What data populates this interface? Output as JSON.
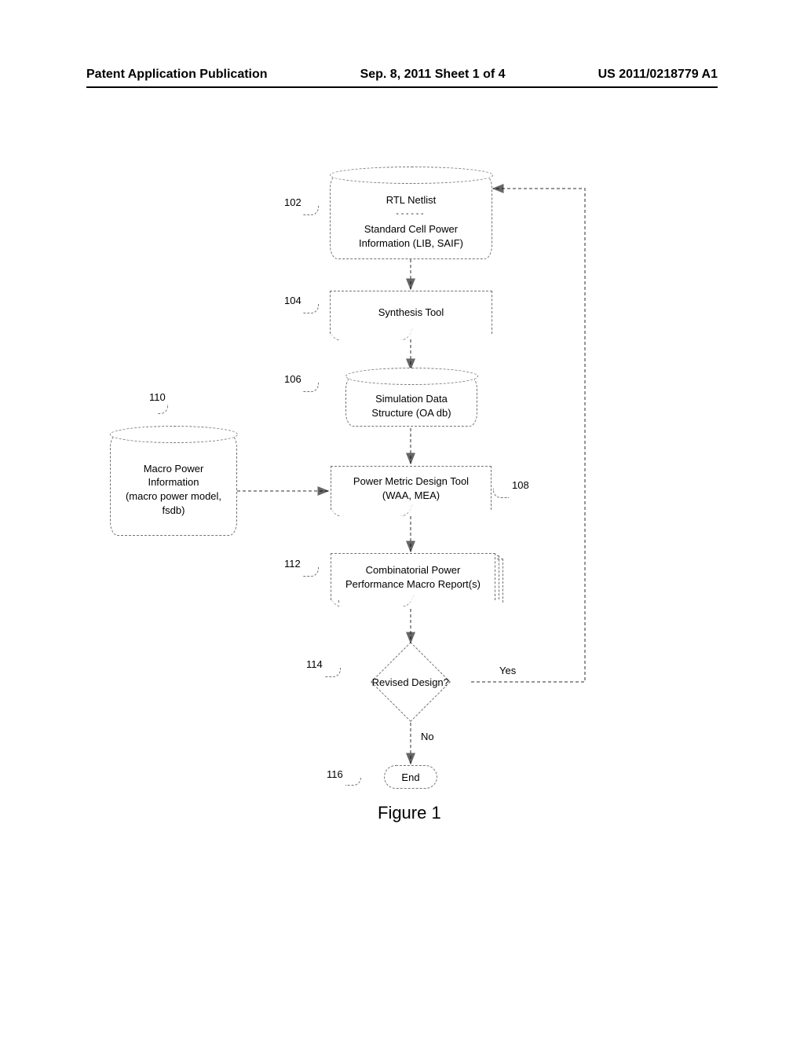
{
  "header": {
    "left": "Patent Application Publication",
    "center": "Sep. 8, 2011  Sheet 1 of 4",
    "right": "US 2011/0218779 A1"
  },
  "nodes": {
    "n102": {
      "ref": "102",
      "line1": "RTL Netlist",
      "divider": "------",
      "line2": "Standard Cell Power",
      "line3": "Information (LIB, SAIF)"
    },
    "n104": {
      "ref": "104",
      "text": "Synthesis Tool"
    },
    "n106": {
      "ref": "106",
      "line1": "Simulation Data",
      "line2": "Structure (OA db)"
    },
    "n108": {
      "ref": "108",
      "line1": "Power Metric Design Tool",
      "line2": "(WAA, MEA)"
    },
    "n110": {
      "ref": "110",
      "line1": "Macro Power",
      "line2": "Information",
      "line3": "(macro power model,",
      "line4": "fsdb)"
    },
    "n112": {
      "ref": "112",
      "line1": "Combinatorial Power",
      "line2": "Performance Macro Report(s)"
    },
    "n114": {
      "ref": "114",
      "text": "Revised Design?",
      "yes": "Yes",
      "no": "No"
    },
    "n116": {
      "ref": "116",
      "text": "End"
    }
  },
  "figure": "Figure 1"
}
